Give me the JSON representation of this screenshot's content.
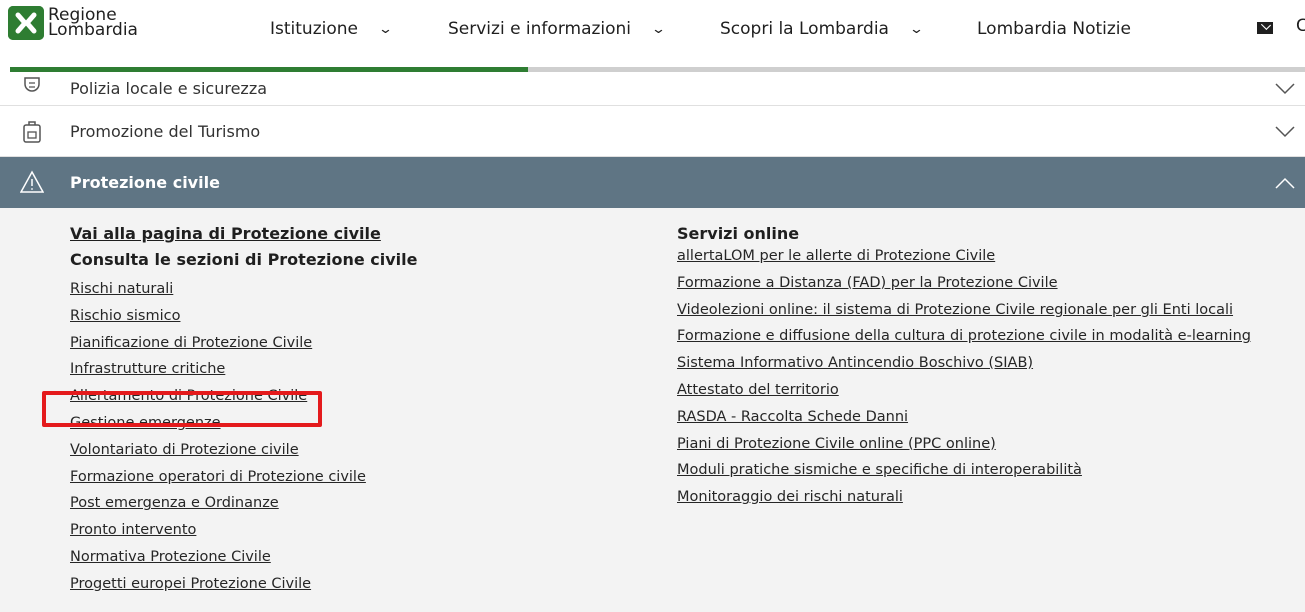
{
  "header": {
    "logo_line1": "Regione",
    "logo_line2": "Lombardia",
    "nav": [
      {
        "label": "Istituzione",
        "chevron": "⌄"
      },
      {
        "label": "Servizi e informazioni",
        "chevron": "⌄"
      },
      {
        "label": "Scopri la Lombardia",
        "chevron": "⌄"
      },
      {
        "label": "Lombardia Notizie",
        "chevron": ""
      }
    ],
    "cut_text": "C"
  },
  "scroll_progress": 0.4,
  "accordion": [
    {
      "label": "Polizia locale e sicurezza",
      "icon": "police-icon",
      "expanded": false
    },
    {
      "label": "Promozione del Turismo",
      "icon": "backpack-icon",
      "expanded": false
    },
    {
      "label": "Protezione civile",
      "icon": "warning-icon",
      "expanded": true
    }
  ],
  "panel": {
    "left": {
      "main_link": "Vai alla pagina di Protezione civile",
      "section_title": "Consulta le sezioni di Protezione civile",
      "links": [
        "Rischi naturali",
        "Rischio sismico",
        "Pianificazione di Protezione Civile",
        "Infrastrutture critiche",
        "Allertamento di Protezione Civile",
        "Gestione emergenze",
        "Volontariato di Protezione civile",
        "Formazione operatori di Protezione civile",
        "Post emergenza e Ordinanze",
        "Pronto intervento",
        "Normativa Protezione Civile",
        "Progetti europei Protezione Civile"
      ]
    },
    "right": {
      "section_title": "Servizi online",
      "links": [
        "allertaLOM per le allerte di Protezione Civile",
        "Formazione a Distanza (FAD) per la Protezione Civile",
        "Videolezioni online: il sistema di Protezione Civile regionale per gli Enti locali",
        "Formazione e diffusione della cultura di protezione civile in modalità e-learning",
        "Sistema Informativo Antincendio Boschivo (SIAB)",
        "Attestato del territorio",
        "RASDA - Raccolta Schede Danni",
        "Piani di Protezione Civile online (PPC online)",
        "Moduli pratiche sismiche e specifiche di interoperabilità",
        "Monitoraggio dei rischi naturali"
      ]
    }
  },
  "colors": {
    "brand_green": "#2e7d32",
    "active_row": "#5f7584",
    "highlight": "#e41a1c"
  }
}
